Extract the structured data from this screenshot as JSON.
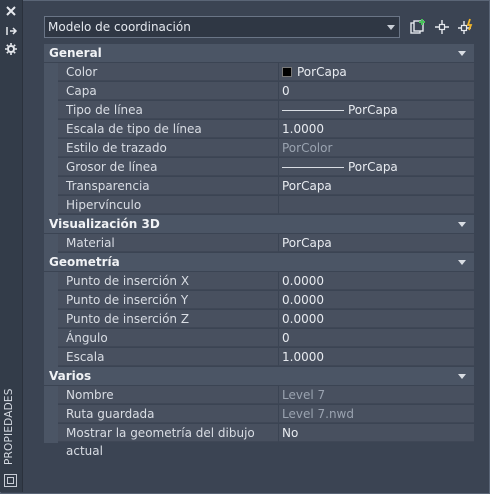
{
  "sidebar": {
    "label": "PROPIEDADES"
  },
  "topbar": {
    "combo_value": "Modelo de coordinación"
  },
  "sections": [
    {
      "title": "General",
      "rows": [
        {
          "name": "Color",
          "value": "PorCapa",
          "kind": "swatch"
        },
        {
          "name": "Capa",
          "value": "0"
        },
        {
          "name": "Tipo de línea",
          "value": "PorCapa",
          "kind": "line"
        },
        {
          "name": "Escala de tipo de línea",
          "value": "1.0000"
        },
        {
          "name": "Estilo de trazado",
          "value": "PorColor",
          "dim": true
        },
        {
          "name": "Grosor de línea",
          "value": "PorCapa",
          "kind": "line"
        },
        {
          "name": "Transparencia",
          "value": "PorCapa"
        },
        {
          "name": "Hipervínculo",
          "value": ""
        }
      ]
    },
    {
      "title": "Visualización 3D",
      "rows": [
        {
          "name": "Material",
          "value": "PorCapa"
        }
      ]
    },
    {
      "title": "Geometría",
      "rows": [
        {
          "name": "Punto de inserción X",
          "value": "0.0000"
        },
        {
          "name": "Punto de inserción Y",
          "value": "0.0000"
        },
        {
          "name": "Punto de inserción Z",
          "value": "0.0000"
        },
        {
          "name": "Ángulo",
          "value": "0"
        },
        {
          "name": "Escala",
          "value": "1.0000"
        }
      ]
    },
    {
      "title": "Varios",
      "rows": [
        {
          "name": "Nombre",
          "value": "Level 7",
          "dim": true
        },
        {
          "name": "Ruta guardada",
          "value": "Level 7.nwd",
          "dim": true
        },
        {
          "name": "Mostrar la geometría del dibujo actual",
          "value": "No"
        }
      ]
    }
  ]
}
